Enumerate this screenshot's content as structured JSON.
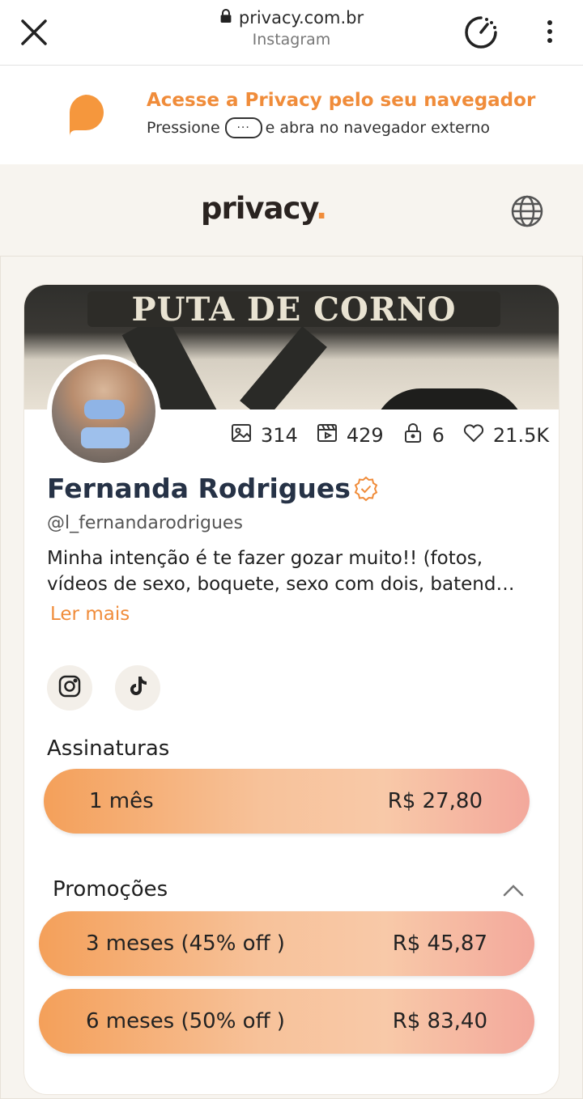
{
  "browser": {
    "host": "privacy.com.br",
    "subtitle": "Instagram"
  },
  "banner": {
    "title": "Acesse a Privacy pelo seu navegador",
    "desc_before": "Pressione",
    "desc_after": "e abra no navegador externo",
    "dots": "···"
  },
  "site": {
    "brand": "privacy",
    "brand_dot": "."
  },
  "cover": {
    "sign_text": "PUTA DE CORNO"
  },
  "profile": {
    "stats": {
      "photos": "314",
      "videos": "429",
      "locked": "6",
      "likes": "21.5K"
    },
    "name": "Fernanda Rodrigues",
    "handle": "@l_fernandarodrigues",
    "bio": "Minha intenção é te fazer gozar muito!! (fotos, vídeos de sexo, boquete, sexo com dois, batend…",
    "read_more": "Ler mais"
  },
  "subscriptions": {
    "title": "Assinaturas",
    "plans": [
      {
        "label": "1 mês",
        "price": "R$ 27,80"
      }
    ]
  },
  "promotions": {
    "title": "Promoções",
    "plans": [
      {
        "label": "3 meses (45% off )",
        "price": "R$ 45,87"
      },
      {
        "label": "6 meses (50% off )",
        "price": "R$ 83,40"
      }
    ]
  },
  "colors": {
    "accent": "#f08c3a",
    "name": "#263246"
  }
}
